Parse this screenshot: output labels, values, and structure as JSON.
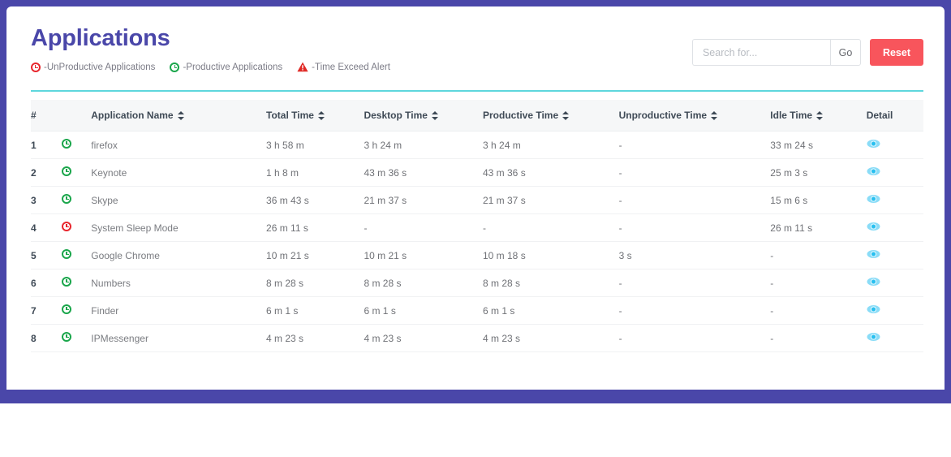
{
  "theme": {
    "frame_color": "#4a47a9",
    "title_color": "#4a47a9",
    "rule_color": "#5ed7dd",
    "reset_color": "#f8555c",
    "eye_color": "#29c0f0",
    "productive_color": "#1aa64b",
    "unproductive_color": "#e8262d",
    "alert_color": "#e02b27"
  },
  "header": {
    "title": "Applications",
    "legend": [
      {
        "icon": "unproductive-clock-icon",
        "label": "-UnProductive Applications",
        "color": "#e8262d"
      },
      {
        "icon": "productive-clock-icon",
        "label": "-Productive Applications",
        "color": "#1aa64b"
      },
      {
        "icon": "warning-triangle-icon",
        "label": "-Time Exceed Alert",
        "color": "#e02b27"
      }
    ]
  },
  "search": {
    "placeholder": "Search for...",
    "value": "",
    "go_label": "Go",
    "reset_label": "Reset"
  },
  "table": {
    "columns": [
      {
        "key": "index",
        "label": "#",
        "sortable": false
      },
      {
        "key": "status",
        "label": "",
        "sortable": false
      },
      {
        "key": "name",
        "label": "Application Name",
        "sortable": true
      },
      {
        "key": "total",
        "label": "Total Time",
        "sortable": true
      },
      {
        "key": "desktop",
        "label": "Desktop Time",
        "sortable": true
      },
      {
        "key": "productive",
        "label": "Productive Time",
        "sortable": true
      },
      {
        "key": "unproductive",
        "label": "Unproductive Time",
        "sortable": true
      },
      {
        "key": "idle",
        "label": "Idle Time",
        "sortable": true
      },
      {
        "key": "detail",
        "label": "Detail",
        "sortable": false
      }
    ],
    "rows": [
      {
        "index": "1",
        "status": "productive",
        "name": "firefox",
        "total": "3 h 58 m",
        "desktop": "3 h 24 m",
        "productive": "3 h 24 m",
        "unproductive": "-",
        "idle": "33 m 24 s",
        "detail": "eye-icon"
      },
      {
        "index": "2",
        "status": "productive",
        "name": "Keynote",
        "total": "1 h 8 m",
        "desktop": "43 m 36 s",
        "productive": "43 m 36 s",
        "unproductive": "-",
        "idle": "25 m 3 s",
        "detail": "eye-icon"
      },
      {
        "index": "3",
        "status": "productive",
        "name": "Skype",
        "total": "36 m 43 s",
        "desktop": "21 m 37 s",
        "productive": "21 m 37 s",
        "unproductive": "-",
        "idle": "15 m 6 s",
        "detail": "eye-icon"
      },
      {
        "index": "4",
        "status": "unproductive",
        "name": "System Sleep Mode",
        "total": "26 m 11 s",
        "desktop": "-",
        "productive": "-",
        "unproductive": "-",
        "idle": "26 m 11 s",
        "detail": "eye-icon"
      },
      {
        "index": "5",
        "status": "productive",
        "name": "Google Chrome",
        "total": "10 m 21 s",
        "desktop": "10 m 21 s",
        "productive": "10 m 18 s",
        "unproductive": "3 s",
        "idle": "-",
        "detail": "eye-icon"
      },
      {
        "index": "6",
        "status": "productive",
        "name": "Numbers",
        "total": "8 m 28 s",
        "desktop": "8 m 28 s",
        "productive": "8 m 28 s",
        "unproductive": "-",
        "idle": "-",
        "detail": "eye-icon"
      },
      {
        "index": "7",
        "status": "productive",
        "name": "Finder",
        "total": "6 m 1 s",
        "desktop": "6 m 1 s",
        "productive": "6 m 1 s",
        "unproductive": "-",
        "idle": "-",
        "detail": "eye-icon"
      },
      {
        "index": "8",
        "status": "productive",
        "name": "IPMessenger",
        "total": "4 m 23 s",
        "desktop": "4 m 23 s",
        "productive": "4 m 23 s",
        "unproductive": "-",
        "idle": "-",
        "detail": "eye-icon"
      }
    ]
  }
}
